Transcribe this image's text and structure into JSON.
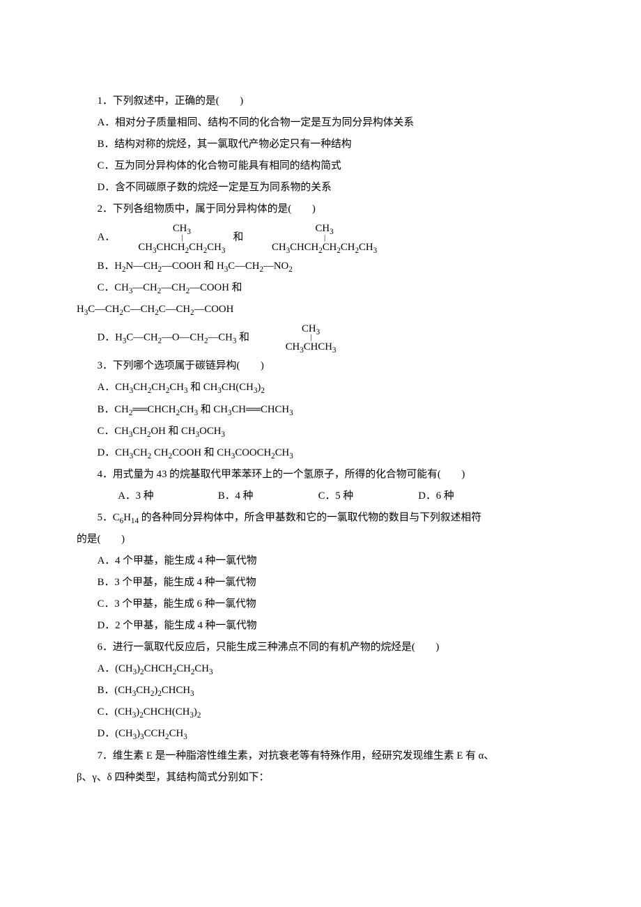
{
  "q1": {
    "stem": "1．下列叙述中，正确的是(　　)",
    "a": "A．相对分子质量相同、结构不同的化合物一定是互为同分异构体关系",
    "b": "B．结构对称的烷烃，其一氯取代产物必定只有一种结构",
    "c": "C．互为同分异构体的化合物可能具有相同的结构简式",
    "d": "D．含不同碳原子数的烷烃一定是互为同系物的关系"
  },
  "q2": {
    "stem": "2．下列各组物质中，属于同分异构体的是(　　)",
    "a_prefix": "A．",
    "a_top1": "CH",
    "a_main1_pre": "CH",
    "a_main1_mid": "CHCH",
    "a_main1_suf": "CH",
    "a_main1_end": "CH",
    "and": "和",
    "a_top2": "CH",
    "a_main2_pre": "CH",
    "a_main2_mid": "CHCH",
    "a_main2_ch2a": "CH",
    "a_main2_ch2b": "CH",
    "a_main2_end": "CH",
    "b_pre": "B．H",
    "b_mid1": "N—CH",
    "b_mid2": "—COOH 和 H",
    "b_mid3": "C—CH",
    "b_end": "—NO",
    "c_pre": "C．CH",
    "c_mid": "—CH",
    "c_end": "—COOH 和",
    "c2_pre": "H",
    "c2_mid": "C—CH",
    "c2_end": "—COOH",
    "d_prefix": "D．H",
    "d_mid1": "C—CH",
    "d_mid2": "—O—CH",
    "d_mid3": "—CH",
    "d_and": " 和",
    "d_top": "CH",
    "d_main_pre": "CH",
    "d_main_mid": "CHCH"
  },
  "q3": {
    "stem": "3．下列哪个选项属于碳链异构(　　)",
    "a_pre": "A．CH",
    "a_m1": "CH",
    "a_m2": "CH",
    "a_m3": "CH",
    "a_and": " 和 CH",
    "a_e1": "CH(CH",
    "a_e2": ")",
    "b_pre": "B．CH",
    "b_db1": "══",
    "b_m1": "CHCH",
    "b_m2": "CH",
    "b_and": " 和 CH",
    "b_m3": "CH",
    "b_db2": "══",
    "b_end": "CHCH",
    "c_pre": "C．CH",
    "c_m1": "CH",
    "c_m2": "OH 和 CH",
    "c_end": "OCH",
    "d_pre": "D．CH",
    "d_m1": "CH",
    "d_m2": " CH",
    "d_m3": "COOH 和 CH",
    "d_m4": "COOCH",
    "d_end": "CH"
  },
  "q4": {
    "stem": "4．用式量为 43 的烷基取代甲苯苯环上的一个氢原子，所得的化合物可能有(　　)",
    "a": "A．3 种",
    "b": "B．4 种",
    "c": "C．5 种",
    "d": "D．6 种"
  },
  "q5": {
    "stem_pre": "5．C",
    "stem_mid": "H",
    "stem_post": " 的各种同分异构体中，所含甲基数和它的一氯取代物的数目与下列叙述相符",
    "stem_tail": "的是(　　)",
    "a": "A．4 个甲基，能生成 4 种一氯代物",
    "b": "B．3 个甲基，能生成 4 种一氯代物",
    "c": "C．3 个甲基，能生成 6 种一氯代物",
    "d": "D．2 个甲基，能生成 4 种一氯代物"
  },
  "q6": {
    "stem": "6．进行一氯取代反应后，只能生成三种沸点不同的有机产物的烷烃是(　　)",
    "a_pre": "A．(CH",
    "a_m1": ")",
    "a_m2": "CHCH",
    "a_m3": "CH",
    "a_end": "CH",
    "b_pre": "B．(CH",
    "b_m1": "CH",
    "b_m2": ")",
    "b_end": "CHCH",
    "c_pre": "C．(CH",
    "c_m1": ")",
    "c_m2": "CHCH(CH",
    "c_end": ")",
    "d_pre": "D．(CH",
    "d_m1": ")",
    "d_m2": "CCH",
    "d_end": "CH"
  },
  "q7": {
    "stem_l1": "7．维生素 E 是一种脂溶性维生素，对抗衰老等有特殊作用，经研究发现维生素 E 有 α、",
    "stem_l2": "β、γ、δ 四种类型，其结构简式分别如下："
  }
}
